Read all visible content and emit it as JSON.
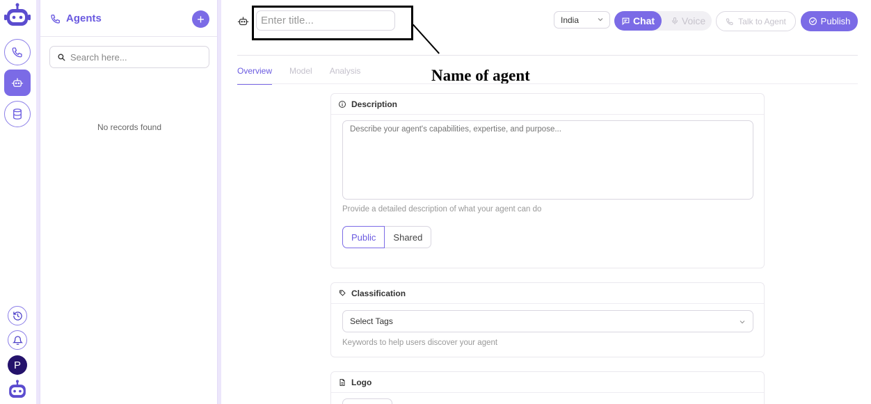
{
  "agents_panel": {
    "title": "Agents",
    "search_placeholder": "Search here...",
    "empty_text": "No records found"
  },
  "rail": {
    "avatar_initial": "P",
    "accent": "#7b6be6"
  },
  "header": {
    "title_placeholder": "Enter title...",
    "country": "India",
    "mode_chat": "Chat",
    "mode_voice": "Voice",
    "talk_label": "Talk to Agent",
    "publish_label": "Publish"
  },
  "annotation": {
    "label": "Name of agent"
  },
  "tabs": [
    {
      "label": "Overview"
    },
    {
      "label": "Model"
    },
    {
      "label": "Analysis"
    }
  ],
  "description": {
    "title": "Description",
    "placeholder": "Describe your agent's capabilities, expertise, and purpose...",
    "hint": "Provide a detailed description of what your agent can do",
    "visibility_public": "Public",
    "visibility_shared": "Shared"
  },
  "classification": {
    "title": "Classification",
    "select_label": "Select Tags",
    "hint": "Keywords to help users discover your agent"
  },
  "logo_section": {
    "title": "Logo"
  }
}
